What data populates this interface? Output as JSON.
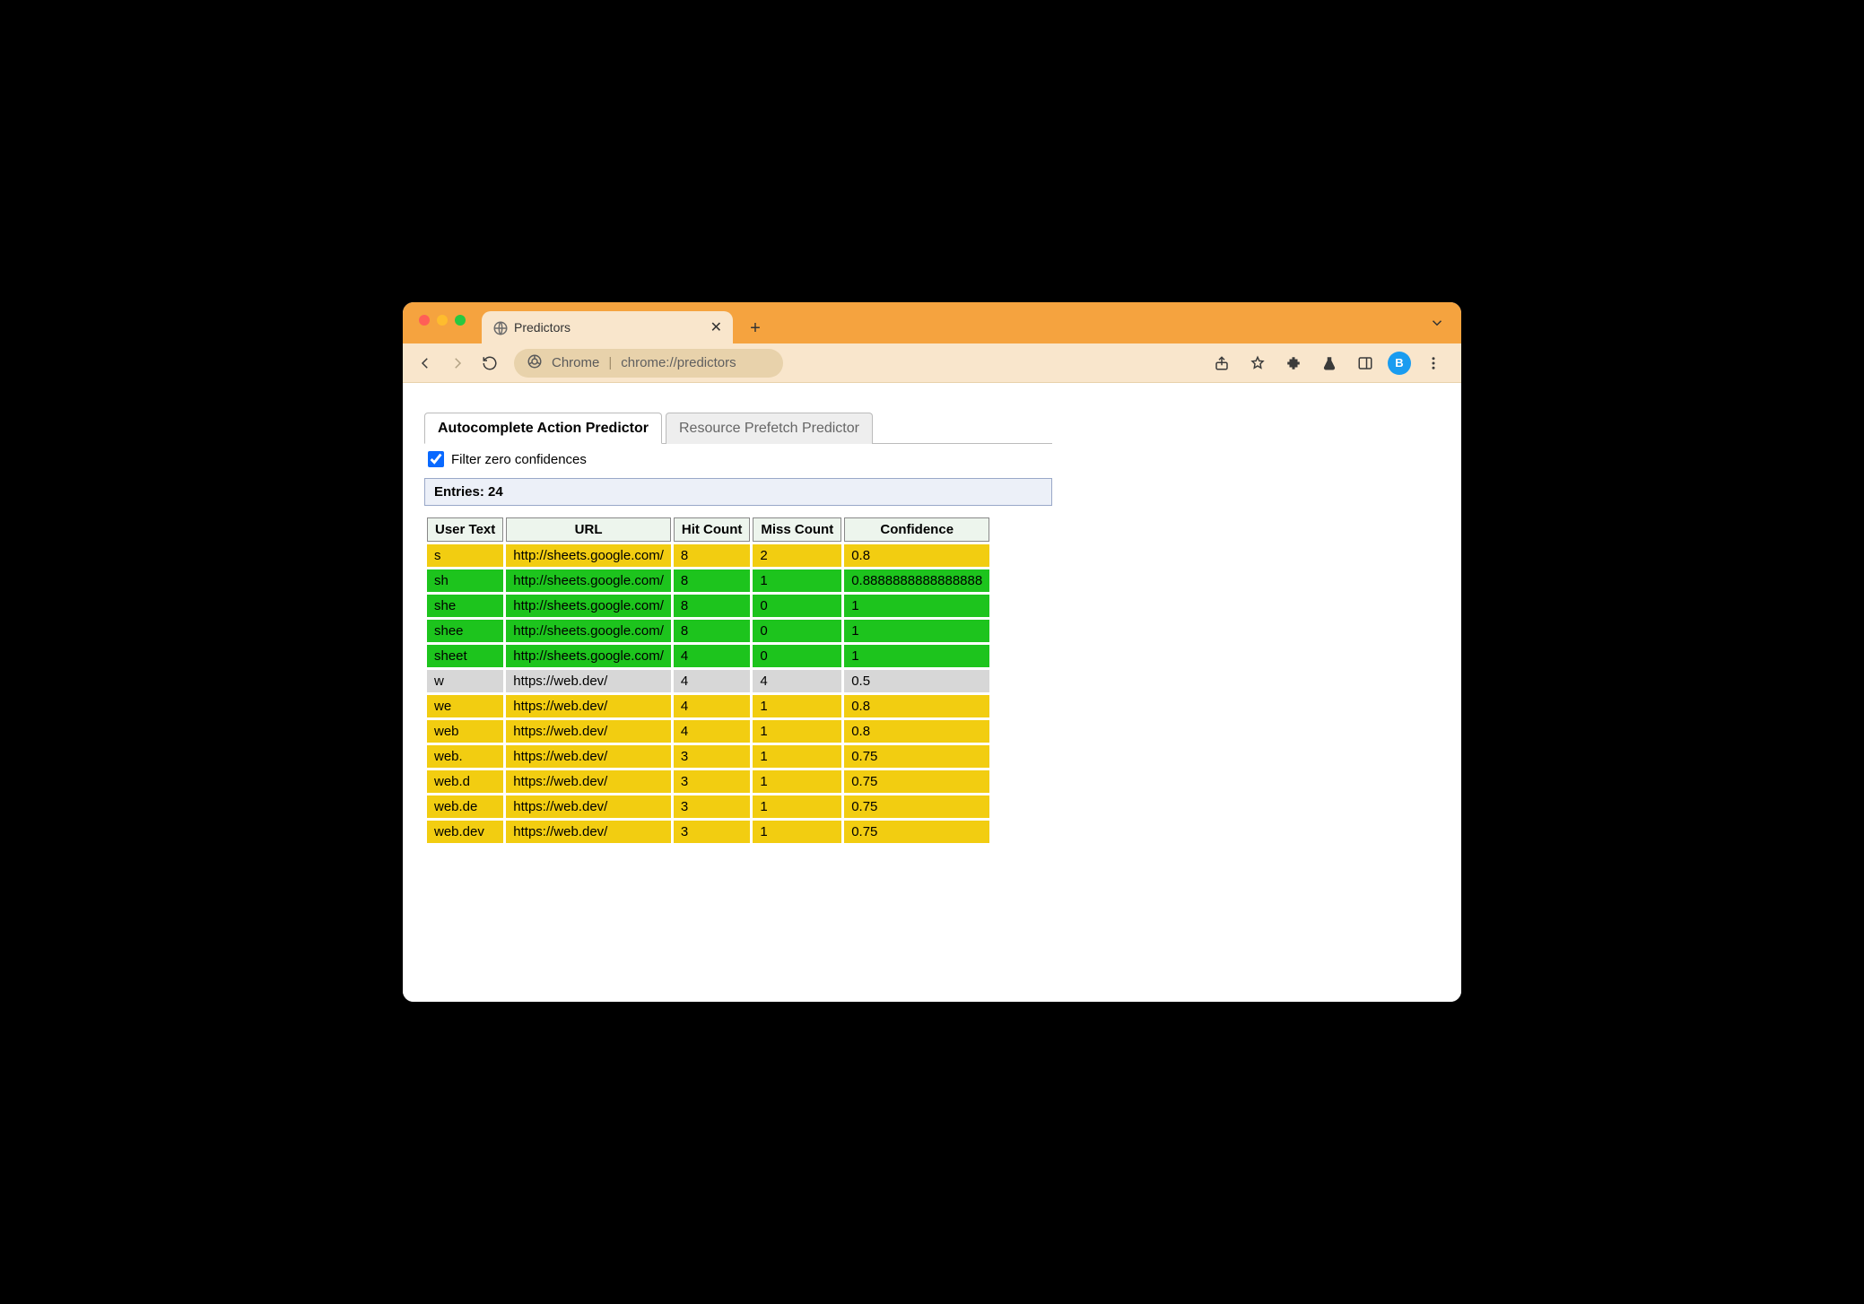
{
  "browser": {
    "tab_title": "Predictors",
    "omnibox_prefix": "Chrome",
    "omnibox_url": "chrome://predictors",
    "avatar_letter": "B"
  },
  "page": {
    "tab_active": "Autocomplete Action Predictor",
    "tab_inactive": "Resource Prefetch Predictor",
    "filter_label": "Filter zero confidences",
    "filter_checked": true,
    "entries_label": "Entries: 24",
    "columns": {
      "user_text": "User Text",
      "url": "URL",
      "hit_count": "Hit Count",
      "miss_count": "Miss Count",
      "confidence": "Confidence"
    },
    "rows": [
      {
        "user_text": "s",
        "url": "http://sheets.google.com/",
        "hit": "8",
        "miss": "2",
        "conf": "0.8",
        "color": "yellow"
      },
      {
        "user_text": "sh",
        "url": "http://sheets.google.com/",
        "hit": "8",
        "miss": "1",
        "conf": "0.8888888888888888",
        "color": "green"
      },
      {
        "user_text": "she",
        "url": "http://sheets.google.com/",
        "hit": "8",
        "miss": "0",
        "conf": "1",
        "color": "green"
      },
      {
        "user_text": "shee",
        "url": "http://sheets.google.com/",
        "hit": "8",
        "miss": "0",
        "conf": "1",
        "color": "green"
      },
      {
        "user_text": "sheet",
        "url": "http://sheets.google.com/",
        "hit": "4",
        "miss": "0",
        "conf": "1",
        "color": "green"
      },
      {
        "user_text": "w",
        "url": "https://web.dev/",
        "hit": "4",
        "miss": "4",
        "conf": "0.5",
        "color": "grey"
      },
      {
        "user_text": "we",
        "url": "https://web.dev/",
        "hit": "4",
        "miss": "1",
        "conf": "0.8",
        "color": "yellow"
      },
      {
        "user_text": "web",
        "url": "https://web.dev/",
        "hit": "4",
        "miss": "1",
        "conf": "0.8",
        "color": "yellow"
      },
      {
        "user_text": "web.",
        "url": "https://web.dev/",
        "hit": "3",
        "miss": "1",
        "conf": "0.75",
        "color": "yellow"
      },
      {
        "user_text": "web.d",
        "url": "https://web.dev/",
        "hit": "3",
        "miss": "1",
        "conf": "0.75",
        "color": "yellow"
      },
      {
        "user_text": "web.de",
        "url": "https://web.dev/",
        "hit": "3",
        "miss": "1",
        "conf": "0.75",
        "color": "yellow"
      },
      {
        "user_text": "web.dev",
        "url": "https://web.dev/",
        "hit": "3",
        "miss": "1",
        "conf": "0.75",
        "color": "yellow"
      }
    ]
  }
}
